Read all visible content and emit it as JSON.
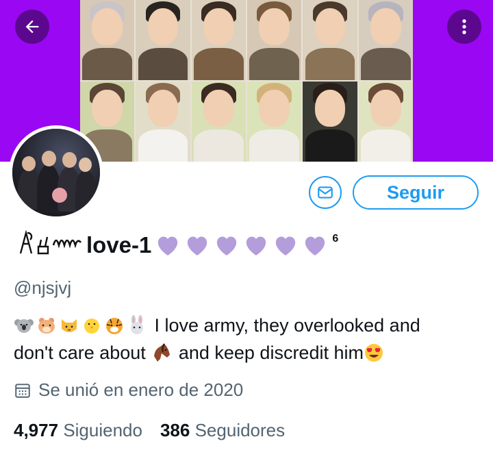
{
  "profile": {
    "display_name_text": "love-1",
    "superscript": "6",
    "handle": "@njsjvj",
    "bio_line1_text": "I love army, they overlooked and",
    "bio_line2_part1": "don't care about",
    "bio_line2_part2": "and keep discredit him",
    "joined": "Se unió en enero de 2020",
    "following_count": "4,977",
    "following_label": "Siguiendo",
    "followers_count": "386",
    "followers_label": "Seguidores"
  },
  "actions": {
    "follow_label": "Seguir"
  },
  "icons": {
    "back": "arrow-left-icon",
    "more": "more-vertical-icon",
    "message": "envelope-icon",
    "calendar": "calendar-icon"
  },
  "colors": {
    "banner": "#9a07f3",
    "accent": "#1d9bf0",
    "heart": "#b39ddb",
    "secondary_text": "#536471"
  }
}
